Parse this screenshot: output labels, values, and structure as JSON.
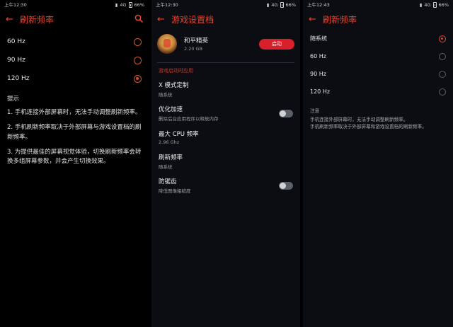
{
  "status_bars": [
    {
      "time": "上午12:30",
      "battery": "66%",
      "network": "4G"
    },
    {
      "time": "上午12:30",
      "battery": "66%",
      "network": "4G"
    },
    {
      "time": "上午12:43",
      "battery": "66%",
      "network": "4G"
    }
  ],
  "screen1": {
    "title": "刷新频率",
    "options": [
      {
        "label": "60 Hz",
        "selected": false
      },
      {
        "label": "90 Hz",
        "selected": false
      },
      {
        "label": "120 Hz",
        "selected": true
      }
    ],
    "tips_title": "提示",
    "tips": [
      "1. 手机连接外部屏幕时，无法手动调整刷新频率。",
      "2. 手机刷新频率取决于外部屏幕与游戏设置档的刷新频率。",
      "3. 为提供最佳的屏幕视觉体验，切换刷新频率会转换多组屏幕参数，并会产生切换效果。"
    ]
  },
  "screen2": {
    "title": "游戏设置档",
    "game": {
      "name": "和平精英",
      "size": "2.20 GB",
      "launch_label": "启动"
    },
    "section_header": "游戏启动时应用",
    "settings": [
      {
        "title": "X 模式定制",
        "subtitle": "随系统",
        "toggle": null
      },
      {
        "title": "优化加速",
        "subtitle": "删除后台应用程序以释放内存",
        "toggle": false
      },
      {
        "title": "最大 CPU 频率",
        "subtitle": "2.96 Ghz",
        "toggle": null
      },
      {
        "title": "刷新频率",
        "subtitle": "随系统",
        "toggle": null
      },
      {
        "title": "防锯齿",
        "subtitle": "降低图像粗糙度",
        "toggle": false
      }
    ]
  },
  "screen3": {
    "title": "刷新频率",
    "options": [
      {
        "label": "随系统",
        "selected": true
      },
      {
        "label": "60 Hz",
        "selected": false
      },
      {
        "label": "90 Hz",
        "selected": false
      },
      {
        "label": "120 Hz",
        "selected": false
      }
    ],
    "note_title": "注意",
    "notes": [
      "手机连接外部屏幕时，无法手动调整刷新频率。",
      "手机刷新频率取决于外部屏幕和游戏设置档的刷新频率。"
    ]
  },
  "colors": {
    "accent": "#e8432f",
    "launch": "#d9202a",
    "bg": "#0b0d12"
  },
  "icons": {
    "back": "arrow-left-icon",
    "search": "search-icon"
  }
}
